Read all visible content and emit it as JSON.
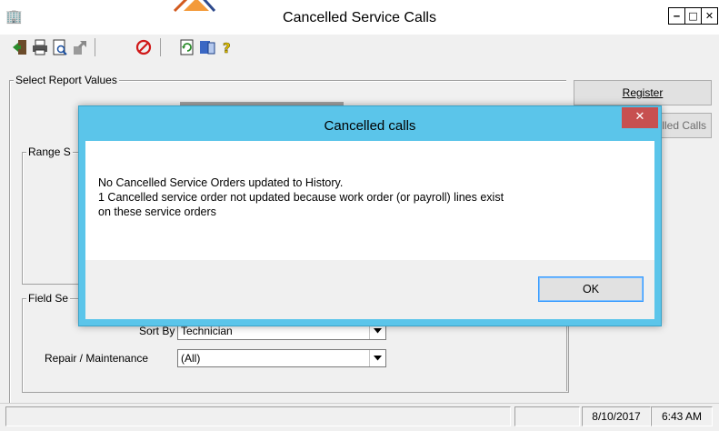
{
  "window": {
    "title": "Cancelled Service Calls",
    "app_icon": "building-icon",
    "controls": [
      "minimize-icon",
      "maximize-icon",
      "close-icon"
    ]
  },
  "toolbar": {
    "icons": [
      "exit-door-icon",
      "print-icon",
      "print-preview-icon",
      "export-icon",
      "cancel-icon",
      "refresh-icon",
      "data-icon",
      "help-icon"
    ]
  },
  "groups": {
    "select_report_values": "Select Report Values",
    "range": "Range S",
    "field": "Field Se"
  },
  "buttons": {
    "register": "Register",
    "cancelled_calls": "lled Calls"
  },
  "fields": {
    "sort_by_label": "Sort By",
    "sort_by_value": "Technician",
    "repair_label": "Repair / Maintenance",
    "repair_value": "(All)"
  },
  "status": {
    "date": "8/10/2017",
    "time": "6:43 AM"
  },
  "dialog": {
    "title": "Cancelled calls",
    "message": "No Cancelled Service Orders updated to History.\n 1 Cancelled service order not updated because work order (or payroll) lines exist\non these service orders",
    "ok_label": "OK",
    "colors": {
      "frame": "#5bc5ea",
      "close": "#c75050",
      "focus": "#3399ff"
    }
  }
}
